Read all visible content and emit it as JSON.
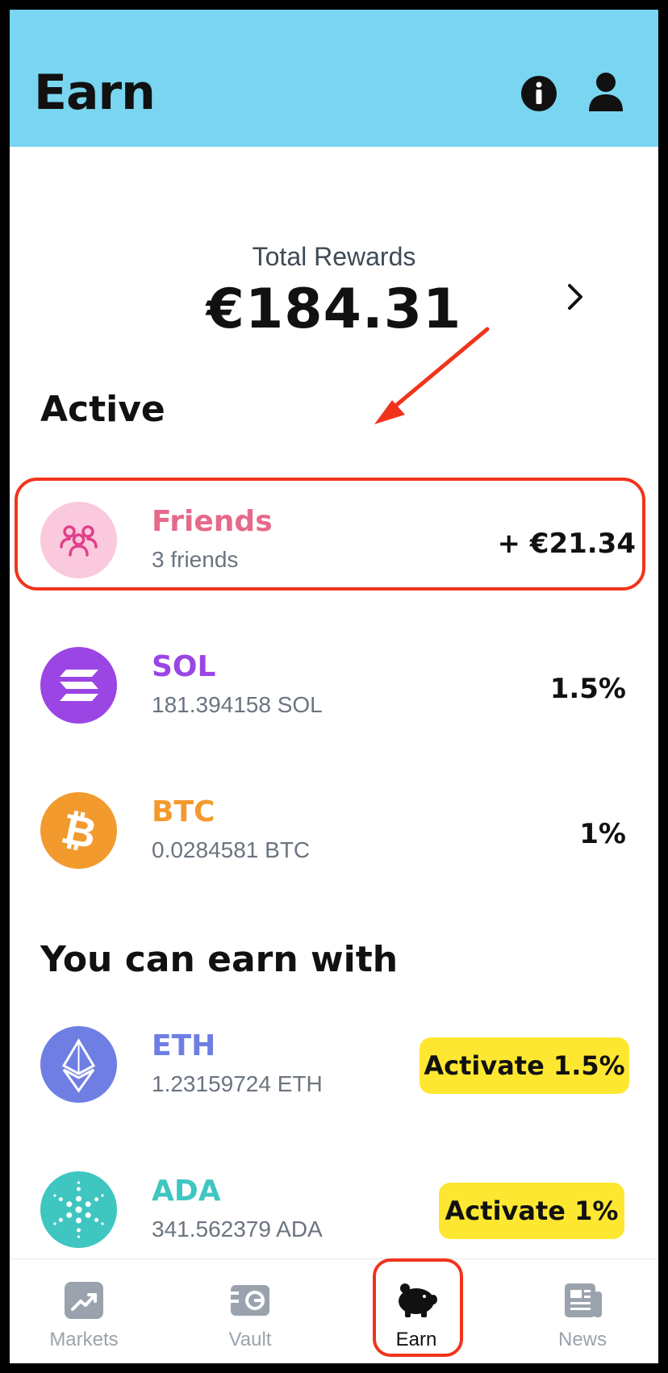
{
  "header": {
    "title": "Earn"
  },
  "total_rewards": {
    "label": "Total Rewards",
    "value": "€184.31"
  },
  "sections": {
    "active": "Active",
    "earn_with": "You can earn with"
  },
  "active": [
    {
      "name": "Friends",
      "sub": "3 friends",
      "value": "+ €21.34",
      "color": "#e66a8a"
    },
    {
      "name": "SOL",
      "sub": "181.394158 SOL",
      "value": "1.5%",
      "color": "#9b45e4"
    },
    {
      "name": "BTC",
      "sub": "0.0284581 BTC",
      "value": "1%",
      "color": "#f29a2e"
    }
  ],
  "earn_with": [
    {
      "name": "ETH",
      "sub": "1.23159724 ETH",
      "action": "Activate 1.5%",
      "color": "#6f7ee3"
    },
    {
      "name": "ADA",
      "sub": "341.562379 ADA",
      "action": "Activate 1%",
      "color": "#3fc6c0"
    }
  ],
  "tabs": [
    {
      "label": "Markets",
      "icon": "chart-up-icon"
    },
    {
      "label": "Vault",
      "icon": "wallet-icon"
    },
    {
      "label": "Earn",
      "icon": "piggy-bank-icon",
      "active": true
    },
    {
      "label": "News",
      "icon": "newspaper-icon"
    }
  ],
  "colors": {
    "header_bg": "#79d5f0",
    "accent_yellow": "#fde731",
    "highlight_red": "#f0341c"
  }
}
